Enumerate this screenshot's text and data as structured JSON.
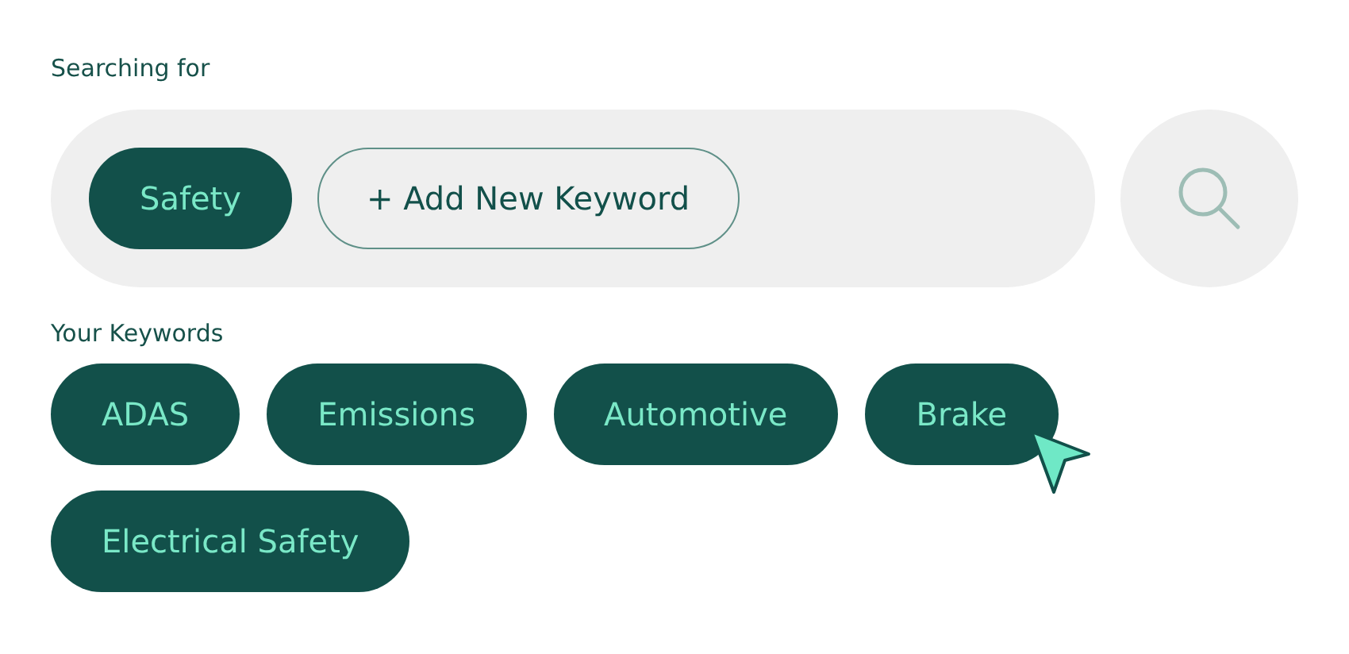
{
  "search_label": "Searching for",
  "active_keywords": [
    {
      "label": "Safety"
    }
  ],
  "add_button": "+ Add New Keyword",
  "keywords_label": "Your Keywords",
  "keywords": [
    {
      "label": "ADAS",
      "hovered": false
    },
    {
      "label": "Emissions",
      "hovered": false
    },
    {
      "label": "Automotive",
      "hovered": false
    },
    {
      "label": "Brake",
      "hovered": true
    },
    {
      "label": "Electrical Safety",
      "hovered": false
    }
  ]
}
